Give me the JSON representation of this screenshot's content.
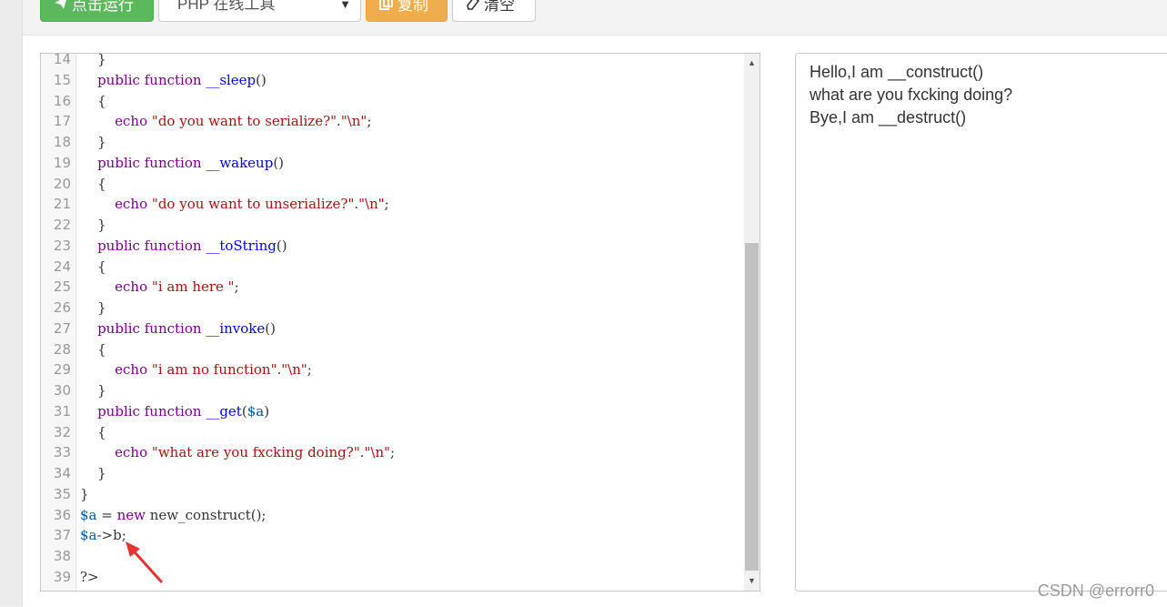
{
  "toolbar": {
    "run_label": "点击运行",
    "run_icon": "paper-plane-icon",
    "lang_selected": "PHP 在线工具",
    "copy_label": "复制",
    "copy_icon": "copy-icon",
    "clear_label": "清空",
    "clear_icon": "eraser-icon"
  },
  "editor": {
    "lines": [
      {
        "n": "14",
        "html": "    }"
      },
      {
        "n": "15",
        "tokens": [
          [
            "    ",
            "plain"
          ],
          [
            "public",
            "kw"
          ],
          [
            " ",
            "plain"
          ],
          [
            "function",
            "kw"
          ],
          [
            " ",
            "plain"
          ],
          [
            "__sleep",
            "def"
          ],
          [
            "()",
            "plain"
          ]
        ]
      },
      {
        "n": "16",
        "tokens": [
          [
            "    {",
            "plain"
          ]
        ]
      },
      {
        "n": "17",
        "tokens": [
          [
            "        ",
            "plain"
          ],
          [
            "echo",
            "kw"
          ],
          [
            " ",
            "plain"
          ],
          [
            "\"do you want to serialize?\"",
            "str"
          ],
          [
            ".",
            "plain"
          ],
          [
            "\"\\n\"",
            "str"
          ],
          [
            ";",
            "plain"
          ]
        ]
      },
      {
        "n": "18",
        "tokens": [
          [
            "    }",
            "plain"
          ]
        ]
      },
      {
        "n": "19",
        "tokens": [
          [
            "    ",
            "plain"
          ],
          [
            "public",
            "kw"
          ],
          [
            " ",
            "plain"
          ],
          [
            "function",
            "kw"
          ],
          [
            " ",
            "plain"
          ],
          [
            "__wakeup",
            "def"
          ],
          [
            "()",
            "plain"
          ]
        ]
      },
      {
        "n": "20",
        "tokens": [
          [
            "    {",
            "plain"
          ]
        ]
      },
      {
        "n": "21",
        "tokens": [
          [
            "        ",
            "plain"
          ],
          [
            "echo",
            "kw"
          ],
          [
            " ",
            "plain"
          ],
          [
            "\"do you want to unserialize?\"",
            "str"
          ],
          [
            ".",
            "plain"
          ],
          [
            "\"\\n\"",
            "str"
          ],
          [
            ";",
            "plain"
          ]
        ]
      },
      {
        "n": "22",
        "tokens": [
          [
            "    }",
            "plain"
          ]
        ]
      },
      {
        "n": "23",
        "tokens": [
          [
            "    ",
            "plain"
          ],
          [
            "public",
            "kw"
          ],
          [
            " ",
            "plain"
          ],
          [
            "function",
            "kw"
          ],
          [
            " ",
            "plain"
          ],
          [
            "__toString",
            "def"
          ],
          [
            "()",
            "plain"
          ]
        ]
      },
      {
        "n": "24",
        "tokens": [
          [
            "    {",
            "plain"
          ]
        ]
      },
      {
        "n": "25",
        "tokens": [
          [
            "        ",
            "plain"
          ],
          [
            "echo",
            "kw"
          ],
          [
            " ",
            "plain"
          ],
          [
            "\"i am here \"",
            "str"
          ],
          [
            ";",
            "plain"
          ]
        ]
      },
      {
        "n": "26",
        "tokens": [
          [
            "    }",
            "plain"
          ]
        ]
      },
      {
        "n": "27",
        "tokens": [
          [
            "    ",
            "plain"
          ],
          [
            "public",
            "kw"
          ],
          [
            " ",
            "plain"
          ],
          [
            "function",
            "kw"
          ],
          [
            " ",
            "plain"
          ],
          [
            "__invoke",
            "def"
          ],
          [
            "()",
            "plain"
          ]
        ]
      },
      {
        "n": "28",
        "tokens": [
          [
            "    {",
            "plain"
          ]
        ]
      },
      {
        "n": "29",
        "tokens": [
          [
            "        ",
            "plain"
          ],
          [
            "echo",
            "kw"
          ],
          [
            " ",
            "plain"
          ],
          [
            "\"i am no function\"",
            "str"
          ],
          [
            ".",
            "plain"
          ],
          [
            "\"\\n\"",
            "str"
          ],
          [
            ";",
            "plain"
          ]
        ]
      },
      {
        "n": "30",
        "tokens": [
          [
            "    }",
            "plain"
          ]
        ]
      },
      {
        "n": "31",
        "tokens": [
          [
            "    ",
            "plain"
          ],
          [
            "public",
            "kw"
          ],
          [
            " ",
            "plain"
          ],
          [
            "function",
            "kw"
          ],
          [
            " ",
            "plain"
          ],
          [
            "__get",
            "def"
          ],
          [
            "(",
            "plain"
          ],
          [
            "$a",
            "var"
          ],
          [
            ")",
            "plain"
          ]
        ]
      },
      {
        "n": "32",
        "tokens": [
          [
            "    {",
            "plain"
          ]
        ]
      },
      {
        "n": "33",
        "tokens": [
          [
            "        ",
            "plain"
          ],
          [
            "echo",
            "kw"
          ],
          [
            " ",
            "plain"
          ],
          [
            "\"what are you fxcking doing?\"",
            "str"
          ],
          [
            ".",
            "plain"
          ],
          [
            "\"\\n\"",
            "str"
          ],
          [
            ";",
            "plain"
          ]
        ]
      },
      {
        "n": "34",
        "tokens": [
          [
            "    }",
            "plain"
          ]
        ]
      },
      {
        "n": "35",
        "tokens": [
          [
            "}",
            "plain"
          ]
        ]
      },
      {
        "n": "36",
        "tokens": [
          [
            "$a",
            "var"
          ],
          [
            " = ",
            "plain"
          ],
          [
            "new",
            "kw"
          ],
          [
            " new_construct();",
            "plain"
          ]
        ]
      },
      {
        "n": "37",
        "tokens": [
          [
            "$a",
            "var"
          ],
          [
            "->b;",
            "plain"
          ]
        ]
      },
      {
        "n": "38",
        "tokens": []
      },
      {
        "n": "39",
        "tokens": [
          [
            "?>",
            "plain"
          ]
        ]
      }
    ]
  },
  "output": {
    "lines": [
      "Hello,I am __construct()",
      "what are you fxcking doing?",
      "Bye,I am __destruct()"
    ]
  },
  "watermark": "CSDN @errorr0",
  "colors": {
    "run": "#5cb85c",
    "copy": "#f0ad4e",
    "arrow": "#e53333"
  }
}
